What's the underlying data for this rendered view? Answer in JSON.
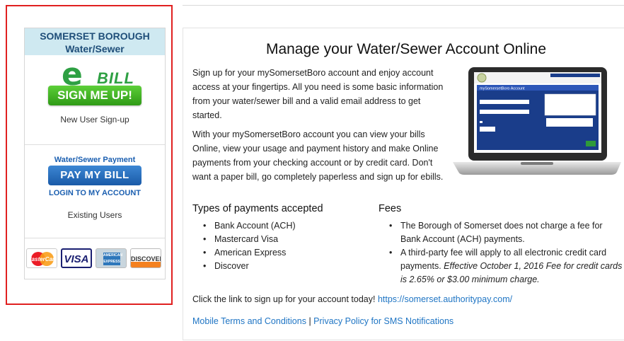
{
  "sidebar": {
    "brand_line1": "SOMERSET BOROUGH",
    "brand_line2": "Water/Sewer",
    "ebill_e": "e",
    "ebill_word": "BILL",
    "signup_button": "SIGN ME UP!",
    "new_user": "New User Sign-up",
    "payment_label": "Water/Sewer Payment",
    "pay_button": "PAY MY BILL",
    "login_link": "LOGIN TO MY ACCOUNT",
    "existing_users": "Existing Users",
    "cards": {
      "mastercard": "MasterCard",
      "visa": "VISA",
      "amex": "AMERICAN EXPRESS",
      "discover": "DISCOVER"
    }
  },
  "main": {
    "title": "Manage your Water/Sewer Account Online",
    "para1": "Sign up for your mySomersetBoro account and enjoy account access at your fingertips. All you need is some basic information from your water/sewer bill and a valid email address to get started.",
    "para2": "With your mySomersetBoro account you can view your bills Online, view your usage and payment history and make Online payments from your checking account or by credit card. Don't want a paper bill, go completely paperless and sign up for ebills.",
    "laptop_screen_title": "mySomersetBoro Account",
    "types_heading": "Types of payments accepted",
    "types": [
      "Bank Account (ACH)",
      "Mastercard Visa",
      "American Express",
      "Discover"
    ],
    "fees_heading": "Fees",
    "fee1": "The Borough of Somerset does not charge a fee for Bank Account (ACH) payments.",
    "fee2_text": "A third-party fee will apply to all electronic credit card payments. ",
    "fee2_italic": "Effective October 1, 2016 Fee for credit cards is 2.65% or $3.00 minimum charge.",
    "cta_text": "Click the link to sign up for your account today! ",
    "cta_link": "https://somerset.authoritypay.com/",
    "link_terms": "Mobile Terms and Conditions",
    "link_sep": " | ",
    "link_privacy": "Privacy Policy for SMS Notifications"
  },
  "colors": {
    "highlight_border": "#e02020",
    "brand_bg": "#cfe9f1",
    "link": "#1f75c4",
    "signup_green": "#2ea043",
    "pay_blue": "#1a5aa8"
  }
}
